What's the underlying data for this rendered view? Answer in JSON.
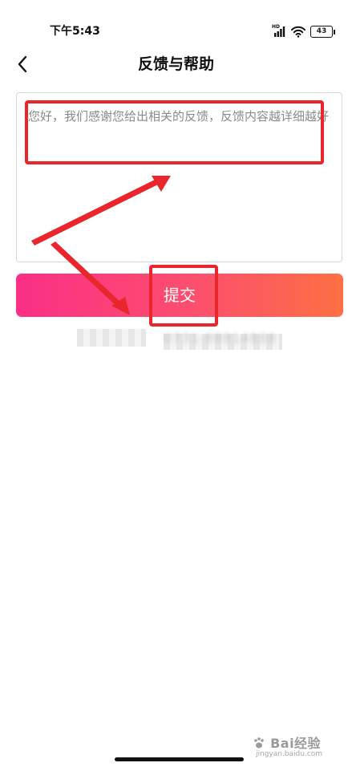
{
  "status_bar": {
    "time": "下午5:43",
    "network_label": "HD",
    "battery": "43"
  },
  "nav": {
    "title": "反馈与帮助",
    "back_icon": "chevron-left-icon"
  },
  "feedback": {
    "placeholder": "您好，我们感谢您给出相关的反馈，反馈内容越详细越好",
    "value": ""
  },
  "submit": {
    "label": "提交"
  },
  "contact": {
    "phone": "0731-88814888"
  },
  "annotations": {
    "highlight_color": "#e8262b",
    "arrow_color": "#e8262b"
  },
  "watermark": {
    "brand": "Bai经验",
    "url": "jingyan.baidu.com"
  },
  "colors": {
    "gradient_start": "#fb2f86",
    "gradient_end": "#fd7043",
    "border": "#d8d8d8",
    "placeholder": "#8a8a8a"
  }
}
